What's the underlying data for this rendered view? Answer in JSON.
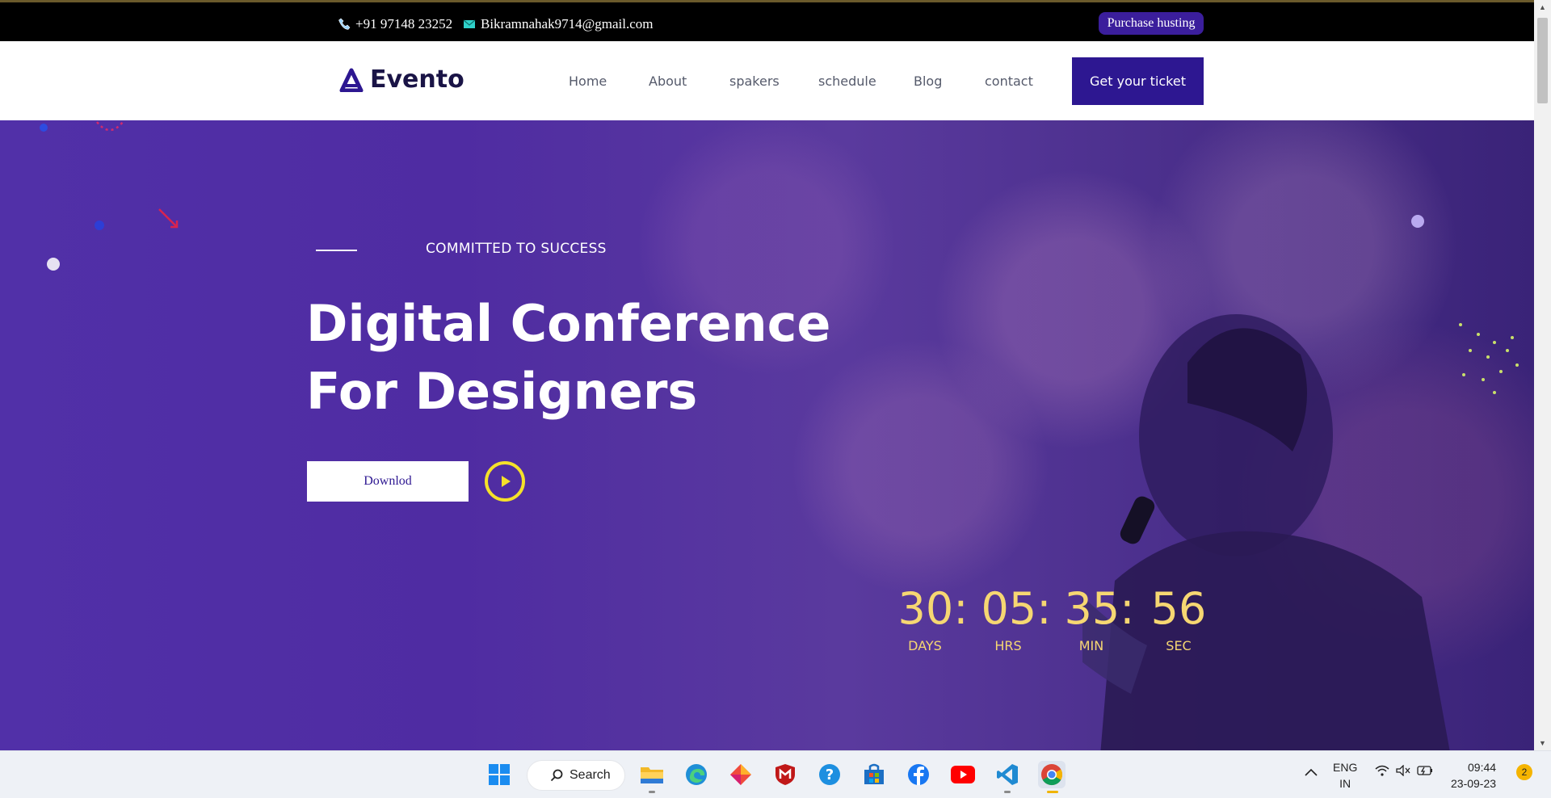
{
  "topbar": {
    "phone": "+91 97148 23252",
    "email": "Bikramnahak9714@gmail.com",
    "purchase_label": "Purchase husting"
  },
  "nav": {
    "brand": "Evento",
    "items": [
      "Home",
      "About",
      "spakers",
      "schedule",
      "Blog",
      "contact"
    ],
    "cta_label": "Get your ticket"
  },
  "hero": {
    "tagline": "COMMITTED TO SUCCESS",
    "headline_line1": "Digital Conference",
    "headline_line2": "For Designers",
    "download_label": "Downlod",
    "countdown": [
      {
        "value": "30:",
        "label": "DAYS"
      },
      {
        "value": "05:",
        "label": "HRS"
      },
      {
        "value": "35:",
        "label": "MIN"
      },
      {
        "value": "56",
        "label": "SEC"
      }
    ]
  },
  "taskbar": {
    "search_label": "Search",
    "lang_line1": "ENG",
    "lang_line2": "IN",
    "time": "09:44",
    "date": "23-09-23",
    "notification_count": "2"
  },
  "colors": {
    "brand_purple": "#2d1791",
    "hero_purple": "#5130a8",
    "countdown_yellow": "#f6d772",
    "play_yellow": "#f5e12a"
  }
}
